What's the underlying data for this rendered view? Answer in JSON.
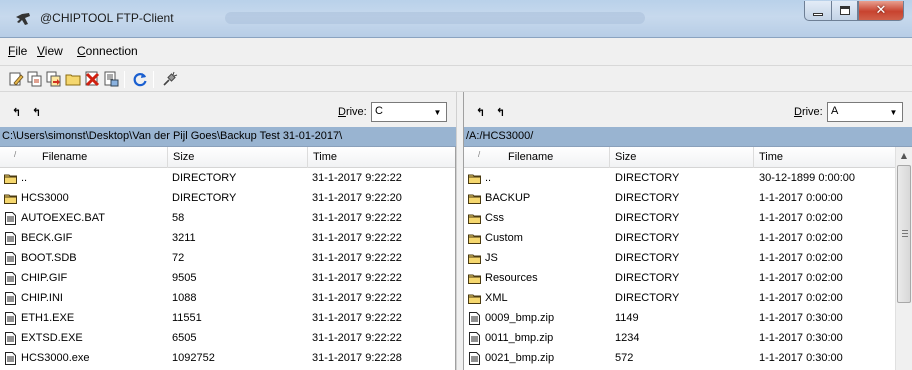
{
  "window": {
    "title": "@CHIPTOOL FTP-Client"
  },
  "menu": [
    {
      "label": "File",
      "accel": "F",
      "rest": "ile"
    },
    {
      "label": "View",
      "accel": "V",
      "rest": "iew"
    },
    {
      "label": "Connection",
      "accel": "C",
      "rest": "onnection"
    }
  ],
  "toolbar_icons": [
    "edit-icon",
    "copy-icon",
    "move-icon",
    "new-folder-icon",
    "delete-icon",
    "properties-icon",
    "refresh-icon",
    "disconnect-icon"
  ],
  "left": {
    "drive_label_accel": "D",
    "drive_label_rest": "rive:",
    "drive_value": "C",
    "path": "C:\\Users\\simonst\\Desktop\\Van der Pijl Goes\\Backup Test 31-01-2017\\",
    "columns": {
      "sort": "/",
      "filename": "Filename",
      "size": "Size",
      "time": "Time"
    },
    "rows": [
      {
        "type": "folder",
        "name": "..",
        "size": "DIRECTORY",
        "time": "31-1-2017 9:22:22"
      },
      {
        "type": "folder",
        "name": "HCS3000",
        "size": "DIRECTORY",
        "time": "31-1-2017 9:22:20"
      },
      {
        "type": "file",
        "name": "AUTOEXEC.BAT",
        "size": "58",
        "time": "31-1-2017 9:22:22"
      },
      {
        "type": "file",
        "name": "BECK.GIF",
        "size": "3211",
        "time": "31-1-2017 9:22:22"
      },
      {
        "type": "file",
        "name": "BOOT.SDB",
        "size": "72",
        "time": "31-1-2017 9:22:22"
      },
      {
        "type": "file",
        "name": "CHIP.GIF",
        "size": "9505",
        "time": "31-1-2017 9:22:22"
      },
      {
        "type": "file",
        "name": "CHIP.INI",
        "size": "1088",
        "time": "31-1-2017 9:22:22"
      },
      {
        "type": "file",
        "name": "ETH1.EXE",
        "size": "11551",
        "time": "31-1-2017 9:22:22"
      },
      {
        "type": "file",
        "name": "EXTSD.EXE",
        "size": "6505",
        "time": "31-1-2017 9:22:22"
      },
      {
        "type": "file",
        "name": "HCS3000.exe",
        "size": "1092752",
        "time": "31-1-2017 9:22:28"
      }
    ]
  },
  "right": {
    "drive_label_accel": "D",
    "drive_label_rest": "rive:",
    "drive_value": "A",
    "path": "/A:/HCS3000/",
    "columns": {
      "sort": "/",
      "filename": "Filename",
      "size": "Size",
      "time": "Time"
    },
    "rows": [
      {
        "type": "folder",
        "name": "..",
        "size": "DIRECTORY",
        "time": "30-12-1899 0:00:00"
      },
      {
        "type": "folder",
        "name": "BACKUP",
        "size": "DIRECTORY",
        "time": "1-1-2017 0:00:00"
      },
      {
        "type": "folder",
        "name": "Css",
        "size": "DIRECTORY",
        "time": "1-1-2017 0:02:00"
      },
      {
        "type": "folder",
        "name": "Custom",
        "size": "DIRECTORY",
        "time": "1-1-2017 0:02:00"
      },
      {
        "type": "folder",
        "name": "JS",
        "size": "DIRECTORY",
        "time": "1-1-2017 0:02:00"
      },
      {
        "type": "folder",
        "name": "Resources",
        "size": "DIRECTORY",
        "time": "1-1-2017 0:02:00"
      },
      {
        "type": "folder",
        "name": "XML",
        "size": "DIRECTORY",
        "time": "1-1-2017 0:02:00"
      },
      {
        "type": "file",
        "name": "0009_bmp.zip",
        "size": "1149",
        "time": "1-1-2017 0:30:00"
      },
      {
        "type": "file",
        "name": "0011_bmp.zip",
        "size": "1234",
        "time": "1-1-2017 0:30:00"
      },
      {
        "type": "file",
        "name": "0021_bmp.zip",
        "size": "572",
        "time": "1-1-2017 0:30:00"
      }
    ]
  },
  "colors": {
    "path_bar": "#99b4d1",
    "folder": "#f5d76e",
    "titlebar": "#c7d9ed"
  }
}
